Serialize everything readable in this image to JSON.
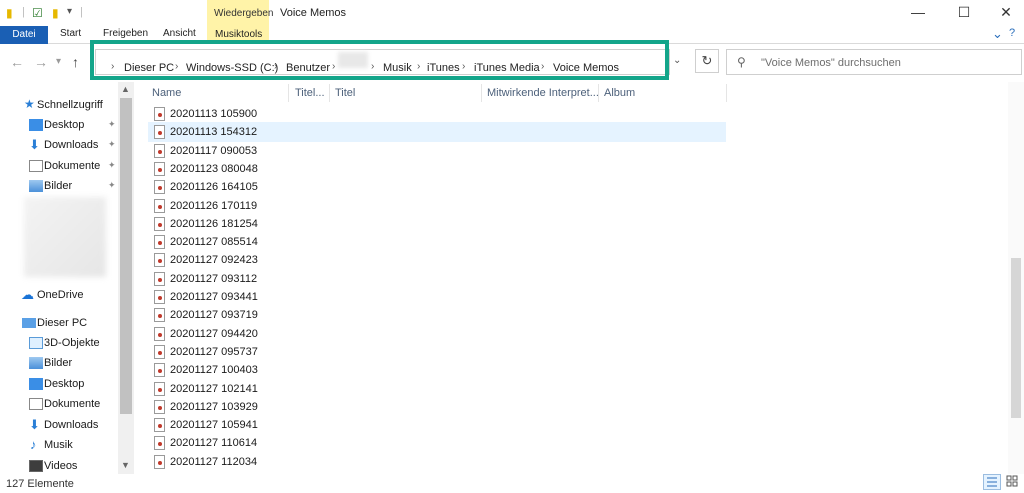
{
  "window": {
    "title": "Voice Memos",
    "context_tab": "Wiedergeben",
    "minimize": "—",
    "maximize": "☐",
    "close": "✕"
  },
  "ribbon": {
    "tabs": [
      "Datei",
      "Start",
      "Freigeben",
      "Ansicht",
      "Musiktools"
    ]
  },
  "address": {
    "crumbs": [
      "Dieser PC",
      "Windows-SSD (C:)",
      "Benutzer",
      "Musik",
      "iTunes",
      "iTunes Media",
      "Voice Memos"
    ],
    "sep": "›"
  },
  "search": {
    "placeholder": "\"Voice Memos\" durchsuchen"
  },
  "nav_pane": {
    "quick_access": "Schnellzugriff",
    "quick_items": [
      "Desktop",
      "Downloads",
      "Dokumente",
      "Bilder"
    ],
    "onedrive": "OneDrive",
    "this_pc": "Dieser PC",
    "pc_items": [
      "3D-Objekte",
      "Bilder",
      "Desktop",
      "Dokumente",
      "Downloads",
      "Musik",
      "Videos"
    ]
  },
  "columns": [
    "Name",
    "Titel...",
    "Titel",
    "Mitwirkende Interpret...",
    "Album"
  ],
  "files": [
    "20201113 105900",
    "20201113 154312",
    "20201117 090053",
    "20201123 080048",
    "20201126 164105",
    "20201126 170119",
    "20201126 181254",
    "20201127 085514",
    "20201127 092423",
    "20201127 093112",
    "20201127 093441",
    "20201127 093719",
    "20201127 094420",
    "20201127 095737",
    "20201127 100403",
    "20201127 102141",
    "20201127 103929",
    "20201127 105941",
    "20201127 110614",
    "20201127 112034"
  ],
  "selected_index": 1,
  "status": {
    "count": "127 Elemente"
  },
  "colors": {
    "highlight_border": "#13a58a",
    "file_tab": "#1a5fb4",
    "context_tab": "#fff3a8",
    "selection": "#e5f3ff"
  }
}
